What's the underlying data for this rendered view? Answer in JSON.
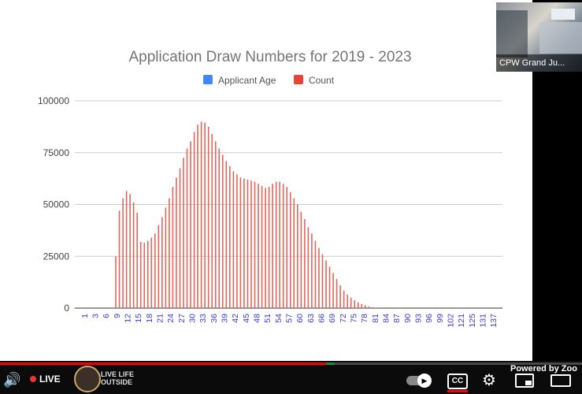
{
  "chart_data": {
    "type": "bar",
    "title": "Application Draw Numbers for 2019 - 2023",
    "legend": [
      {
        "name": "Applicant Age",
        "color": "#4285f4"
      },
      {
        "name": "Count",
        "color": "#ea4335"
      }
    ],
    "legend_position": "top",
    "ylim": [
      0,
      100000
    ],
    "yticks": [
      0,
      25000,
      50000,
      75000,
      100000
    ],
    "grid": true,
    "x_tick_labels": [
      "1",
      "3",
      "6",
      "9",
      "12",
      "15",
      "18",
      "21",
      "24",
      "27",
      "30",
      "33",
      "36",
      "39",
      "42",
      "45",
      "48",
      "51",
      "54",
      "57",
      "60",
      "63",
      "66",
      "69",
      "72",
      "75",
      "78",
      "81",
      "84",
      "87",
      "90",
      "93",
      "96",
      "99",
      "102",
      "121",
      "125",
      "131",
      "137"
    ],
    "ages": [
      1,
      2,
      3,
      4,
      5,
      6,
      7,
      8,
      9,
      10,
      11,
      12,
      13,
      14,
      15,
      16,
      17,
      18,
      19,
      20,
      21,
      22,
      23,
      24,
      25,
      26,
      27,
      28,
      29,
      30,
      31,
      32,
      33,
      34,
      35,
      36,
      37,
      38,
      39,
      40,
      41,
      42,
      43,
      44,
      45,
      46,
      47,
      48,
      49,
      50,
      51,
      52,
      53,
      54,
      55,
      56,
      57,
      58,
      59,
      60,
      61,
      62,
      63,
      64,
      65,
      66,
      67,
      68,
      69,
      70,
      71,
      72,
      73,
      74,
      75,
      76,
      77,
      78,
      79,
      80,
      81,
      82,
      83,
      84,
      85,
      86,
      87,
      88,
      89,
      90,
      91,
      92,
      93,
      94,
      95,
      96,
      97,
      98,
      99,
      100,
      101,
      102,
      103,
      104,
      105,
      106,
      107,
      108,
      109,
      110,
      111,
      112,
      113,
      114,
      115,
      116,
      117,
      118,
      119,
      120
    ],
    "values": [
      0,
      0,
      0,
      0,
      0,
      0,
      0,
      0,
      0,
      0,
      0,
      25000,
      47000,
      53000,
      56500,
      55000,
      51000,
      46000,
      32000,
      31500,
      32500,
      34000,
      36000,
      40000,
      44000,
      48500,
      53000,
      58500,
      63000,
      67500,
      72500,
      77000,
      80500,
      85000,
      88500,
      90000,
      89500,
      87500,
      84000,
      80500,
      77000,
      74000,
      71000,
      68500,
      66000,
      64500,
      63000,
      62500,
      62000,
      61500,
      61000,
      60000,
      59000,
      58000,
      58500,
      60000,
      61000,
      61000,
      60000,
      58500,
      56000,
      53000,
      50000,
      46500,
      43000,
      39000,
      36000,
      32500,
      29000,
      26000,
      23000,
      20000,
      17000,
      14000,
      11000,
      8500,
      6500,
      5000,
      3800,
      2800,
      2000,
      1300,
      800,
      400,
      200,
      100,
      50,
      20,
      10,
      5,
      0,
      0,
      0,
      0,
      0,
      0,
      0,
      0,
      0,
      0,
      0,
      0,
      0,
      0,
      0,
      0,
      0,
      0,
      0,
      0,
      0,
      0,
      0,
      0,
      0,
      0,
      0,
      0,
      0,
      0
    ]
  },
  "video_tile": {
    "label": "CPW Grand Ju..."
  },
  "player": {
    "live_label": "LIVE",
    "tagline_line1": "LIVE LIFE",
    "tagline_line2": "OUTSIDE",
    "cc_label": "CC",
    "powered_by": "Powered by Zoo",
    "progress_percent": 56,
    "icons": {
      "volume": "volume-icon",
      "autoplay": "autoplay-toggle-icon",
      "settings": "gear-icon",
      "miniplayer": "miniplayer-icon",
      "theater": "theater-mode-icon"
    },
    "accent_color": "#ff0000"
  }
}
